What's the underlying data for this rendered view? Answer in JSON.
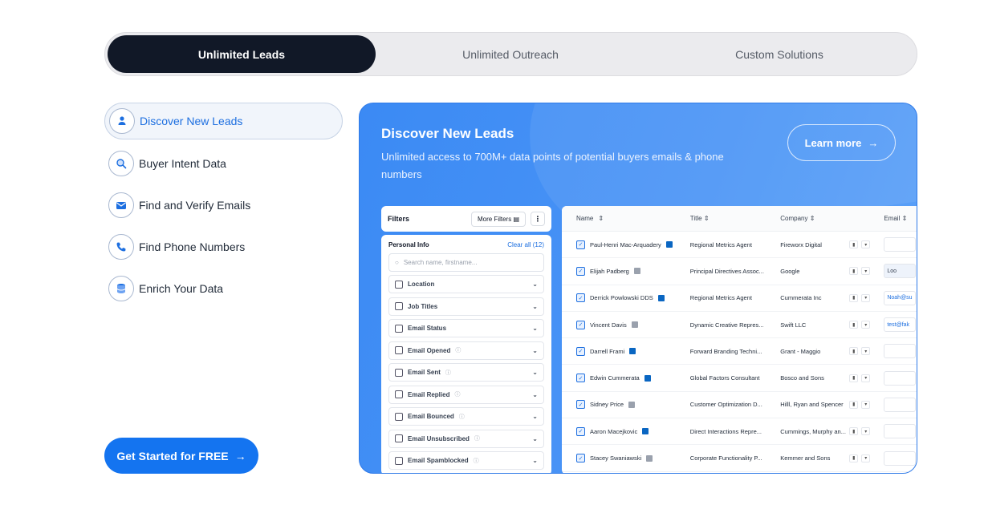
{
  "tabs": [
    {
      "label": "Unlimited  Leads",
      "active": true
    },
    {
      "label": "Unlimited Outreach",
      "active": false
    },
    {
      "label": "Custom Solutions",
      "active": false
    }
  ],
  "menu": [
    {
      "label": "Discover New Leads",
      "icon": "user-icon",
      "active": true
    },
    {
      "label": "Buyer Intent Data",
      "icon": "search-icon",
      "active": false
    },
    {
      "label": "Find and Verify Emails",
      "icon": "envelope-icon",
      "active": false
    },
    {
      "label": "Find Phone Numbers",
      "icon": "phone-icon",
      "active": false
    },
    {
      "label": "Enrich Your Data",
      "icon": "database-icon",
      "active": false
    }
  ],
  "cta": {
    "label": "Get Started for FREE"
  },
  "card": {
    "title": "Discover New Leads",
    "subtitle": "Unlimited access to 700M+ data points of potential buyers emails & phone numbers",
    "learn_more": "Learn more"
  },
  "filters": {
    "title": "Filters",
    "more_filters": "More Filters",
    "section": "Personal Info",
    "clear_all": "Clear all (12)",
    "search_placeholder": "Search name, firstname...",
    "items": [
      {
        "label": "Location",
        "info": false
      },
      {
        "label": "Job Titles",
        "info": false
      },
      {
        "label": "Email Status",
        "info": false
      },
      {
        "label": "Email Opened",
        "info": true
      },
      {
        "label": "Email Sent",
        "info": true
      },
      {
        "label": "Email Replied",
        "info": true
      },
      {
        "label": "Email Bounced",
        "info": true
      },
      {
        "label": "Email Unsubscribed",
        "info": true
      },
      {
        "label": "Email Spamblocked",
        "info": true
      }
    ]
  },
  "table": {
    "headers": {
      "name": "Name",
      "title": "Title",
      "company": "Company",
      "email": "Email"
    },
    "rows": [
      {
        "name": "Paul-Henri Mac-Arquadery",
        "title": "Regional Metrics Agent",
        "company": "Fireworx Digital",
        "email": "",
        "li": true
      },
      {
        "name": "Elijah Padberg",
        "title": "Principal Directives Assoc...",
        "company": "Google",
        "email": "Loo",
        "li": false
      },
      {
        "name": "Derrick Powlowski DDS",
        "title": "Regional Metrics Agent",
        "company": "Cummerata Inc",
        "email": "Noah@su",
        "li": true
      },
      {
        "name": "Vincent Davis",
        "title": "Dynamic Creative Repres...",
        "company": "Swift LLC",
        "email": "test@fak",
        "li": false
      },
      {
        "name": "Darrell Frami",
        "title": "Forward Branding Techni...",
        "company": "Grant - Maggio",
        "email": "",
        "li": true
      },
      {
        "name": "Edwin Cummerata",
        "title": "Global Factors Consultant",
        "company": "Bosco and Sons",
        "email": "",
        "li": true
      },
      {
        "name": "Sidney Price",
        "title": "Customer Optimization D...",
        "company": "Hilll, Ryan and Spencer",
        "email": "",
        "li": false
      },
      {
        "name": "Aaron Macejkovic",
        "title": "Direct Interactions Repre...",
        "company": "Cummings, Murphy an...",
        "email": "",
        "li": true
      },
      {
        "name": "Stacey Swaniawski",
        "title": "Corporate Functionality P...",
        "company": "Kemmer and Sons",
        "email": "",
        "li": false
      }
    ]
  },
  "colors": {
    "accent": "#1474f0",
    "dark_tab": "#111827",
    "card_blue": "#3b8af4"
  }
}
